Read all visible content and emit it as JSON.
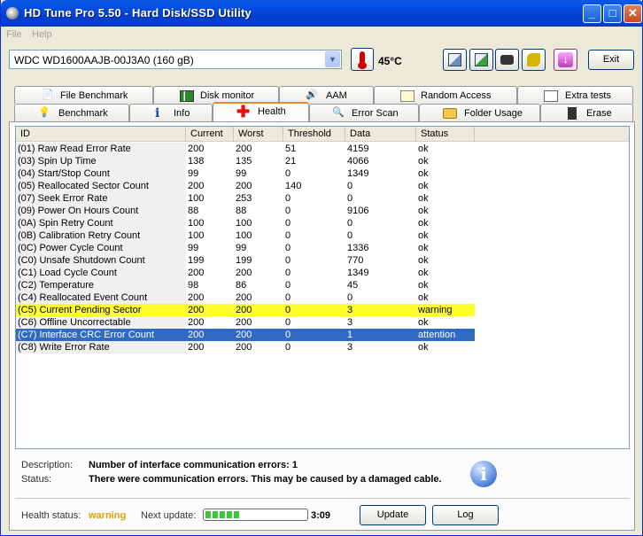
{
  "window": {
    "title": "HD Tune Pro 5.50 - Hard Disk/SSD Utility",
    "minimize_glyph": "_",
    "maximize_glyph": "□",
    "close_glyph": "✕"
  },
  "menu": {
    "file": "File",
    "help": "Help"
  },
  "toolbar": {
    "drive": "WDC WD1600AAJB-00J3A0 (160 gB)",
    "temperature": "45°C",
    "exit_label": "Exit",
    "down_glyph": "↓",
    "icons": [
      "copy-text-icon",
      "copy-screenshot-icon",
      "camera-icon",
      "options-icon",
      "save-down-icon"
    ]
  },
  "tabs": {
    "row1": [
      "File Benchmark",
      "Disk monitor",
      "AAM",
      "Random Access",
      "Extra tests"
    ],
    "row2": [
      "Benchmark",
      "Info",
      "Health",
      "Error Scan",
      "Folder Usage",
      "Erase"
    ],
    "active": "Health"
  },
  "table": {
    "headers": [
      "ID",
      "Current",
      "Worst",
      "Threshold",
      "Data",
      "Status"
    ],
    "rows": [
      [
        "(01) Raw Read Error Rate",
        "200",
        "200",
        "51",
        "4159",
        "ok"
      ],
      [
        "(03) Spin Up Time",
        "138",
        "135",
        "21",
        "4066",
        "ok"
      ],
      [
        "(04) Start/Stop Count",
        "99",
        "99",
        "0",
        "1349",
        "ok"
      ],
      [
        "(05) Reallocated Sector Count",
        "200",
        "200",
        "140",
        "0",
        "ok"
      ],
      [
        "(07) Seek Error Rate",
        "100",
        "253",
        "0",
        "0",
        "ok"
      ],
      [
        "(09) Power On Hours Count",
        "88",
        "88",
        "0",
        "9106",
        "ok"
      ],
      [
        "(0A) Spin Retry Count",
        "100",
        "100",
        "0",
        "0",
        "ok"
      ],
      [
        "(0B) Calibration Retry Count",
        "100",
        "100",
        "0",
        "0",
        "ok"
      ],
      [
        "(0C) Power Cycle Count",
        "99",
        "99",
        "0",
        "1336",
        "ok"
      ],
      [
        "(C0) Unsafe Shutdown Count",
        "199",
        "199",
        "0",
        "770",
        "ok"
      ],
      [
        "(C1) Load Cycle Count",
        "200",
        "200",
        "0",
        "1349",
        "ok"
      ],
      [
        "(C2) Temperature",
        "98",
        "86",
        "0",
        "45",
        "ok"
      ],
      [
        "(C4) Reallocated Event Count",
        "200",
        "200",
        "0",
        "0",
        "ok"
      ],
      [
        "(C5) Current Pending Sector",
        "200",
        "200",
        "0",
        "3",
        "warning"
      ],
      [
        "(C6) Offline Uncorrectable",
        "200",
        "200",
        "0",
        "3",
        "ok"
      ],
      [
        "(C7) Interface CRC Error Count",
        "200",
        "200",
        "0",
        "1",
        "attention"
      ],
      [
        "(C8) Write Error Rate",
        "200",
        "200",
        "0",
        "3",
        "ok"
      ]
    ],
    "highlight_warning_row": 13,
    "selected_row": 15,
    "colors": {
      "warning": "#ffff30",
      "selected": "#316ac5"
    }
  },
  "details": {
    "description_label": "Description:",
    "description": "Number of interface communication errors: 1",
    "status_label": "Status:",
    "status": "There were communication errors. This may be caused by a damaged cable."
  },
  "footer": {
    "health_label": "Health status:",
    "health_value": "warning",
    "next_update_label": "Next update:",
    "progress_fraction": 0.35,
    "countdown": "3:09",
    "update_label": "Update",
    "log_label": "Log"
  }
}
